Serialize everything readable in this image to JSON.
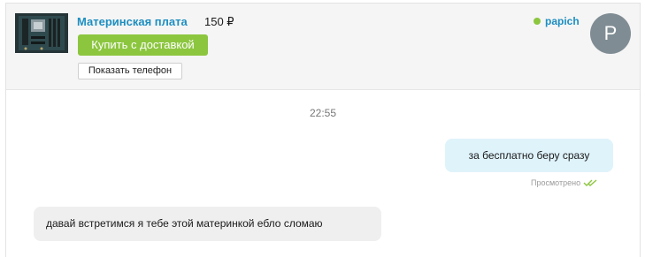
{
  "listing": {
    "title": "Материнская плата",
    "price": "150 ₽",
    "thumbnail_icon": "motherboard-photo",
    "buy_label": "Купить с доставкой",
    "phone_label": "Показать телефон"
  },
  "contact": {
    "name": "papich",
    "status": "online",
    "avatar_letter": "P"
  },
  "chat": {
    "timestamp": "22:55",
    "messages": [
      {
        "direction": "outgoing",
        "text": "за бесплатно беру сразу",
        "status": "Просмотрено"
      },
      {
        "direction": "incoming",
        "text": "давай встретимся я тебе этой материнкой ебло сломаю"
      }
    ]
  },
  "colors": {
    "link": "#1d8ec0",
    "buy_button": "#8cc63f",
    "online": "#8cc63f",
    "outgoing_bubble": "#dff3fb",
    "incoming_bubble": "#efefef",
    "header_bg": "#f5f5f5",
    "avatar_bg": "#7f8c94"
  }
}
